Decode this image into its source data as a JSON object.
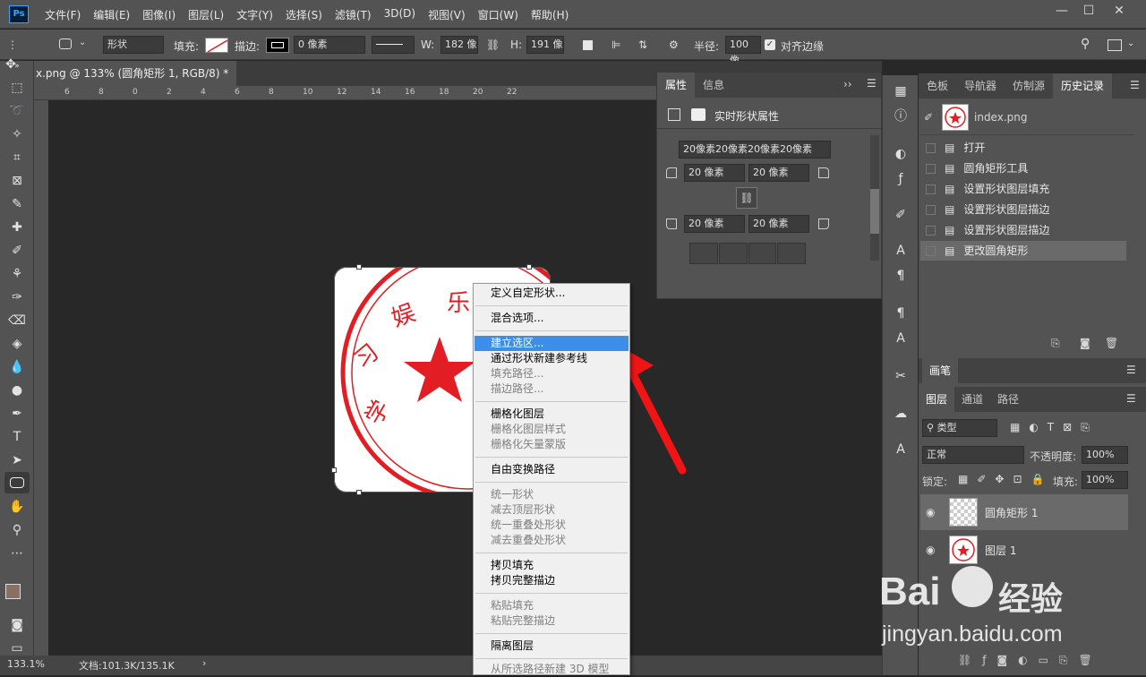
{
  "app": {
    "logo": "Ps"
  },
  "menu": [
    "文件(F)",
    "编辑(E)",
    "图像(I)",
    "图层(L)",
    "文字(Y)",
    "选择(S)",
    "滤镜(T)",
    "3D(D)",
    "视图(V)",
    "窗口(W)",
    "帮助(H)"
  ],
  "options": {
    "mode": "形状",
    "fill_label": "填充:",
    "stroke_label": "描边:",
    "stroke_width": "0 像素",
    "w_label": "W:",
    "w_value": "182 像",
    "h_label": "H:",
    "h_value": "191 像",
    "radius_label": "半径:",
    "radius_value": "100 像",
    "align_edges": "对齐边缘"
  },
  "doc_tab": "x.png @ 133% (圆角矩形 1, RGB/8) *",
  "ruler_ticks": [
    "6",
    "8",
    "0",
    "2",
    "4",
    "6",
    "8",
    "10",
    "12",
    "14",
    "16",
    "18",
    "20",
    "22"
  ],
  "stamp_text": [
    "学",
    "习",
    "娱",
    "乐"
  ],
  "context_menu": [
    {
      "label": "定义自定形状...",
      "disabled": false
    },
    {
      "label": "混合选项...",
      "disabled": false
    },
    {
      "label": "建立选区...",
      "disabled": false,
      "highlighted": true
    },
    {
      "label": "通过形状新建参考线",
      "disabled": false
    },
    {
      "label": "填充路径...",
      "disabled": true
    },
    {
      "label": "描边路径...",
      "disabled": true
    },
    {
      "label": "栅格化图层",
      "disabled": false
    },
    {
      "label": "栅格化图层样式",
      "disabled": true
    },
    {
      "label": "栅格化矢量蒙版",
      "disabled": true
    },
    {
      "label": "自由变换路径",
      "disabled": false
    },
    {
      "label": "统一形状",
      "disabled": true
    },
    {
      "label": "减去顶层形状",
      "disabled": true
    },
    {
      "label": "统一重叠处形状",
      "disabled": true
    },
    {
      "label": "减去重叠处形状",
      "disabled": true
    },
    {
      "label": "拷贝填充",
      "disabled": false
    },
    {
      "label": "拷贝完整描边",
      "disabled": false
    },
    {
      "label": "粘贴填充",
      "disabled": true
    },
    {
      "label": "粘贴完整描边",
      "disabled": true
    },
    {
      "label": "隔离图层",
      "disabled": false
    },
    {
      "label": "从所选路径新建 3D 模型",
      "disabled": true
    }
  ],
  "properties": {
    "tabs": [
      "属性",
      "信息"
    ],
    "title": "实时形状属性",
    "corners_summary": "20像素20像素20像素20像素",
    "corner_tl": "20 像素",
    "corner_tr": "20 像素",
    "corner_bl": "20 像素",
    "corner_br": "20 像素"
  },
  "history": {
    "tabs": [
      "色板",
      "导航器",
      "仿制源",
      "历史记录"
    ],
    "snapshot": "index.png",
    "items": [
      "打开",
      "圆角矩形工具",
      "设置形状图层填充",
      "设置形状图层描边",
      "设置形状图层描边",
      "更改圆角矩形"
    ]
  },
  "brushes_tab": "画笔",
  "layers": {
    "tabs": [
      "图层",
      "通道",
      "路径"
    ],
    "filter": "类型",
    "blend": "正常",
    "opacity_label": "不透明度:",
    "opacity": "100%",
    "lock_label": "锁定:",
    "fill_label": "填充:",
    "fill": "100%",
    "items": [
      "圆角矩形 1",
      "图层 1"
    ]
  },
  "status": {
    "zoom": "133.1%",
    "doc": "文档:101.3K/135.1K"
  },
  "watermark": {
    "brand": "Bai",
    "cn": "经验",
    "url": "jingyan.baidu.com"
  },
  "colors": {
    "accent": "#3d8ee8",
    "stamp_red": "#e31d24",
    "arrow": "#f01414"
  }
}
